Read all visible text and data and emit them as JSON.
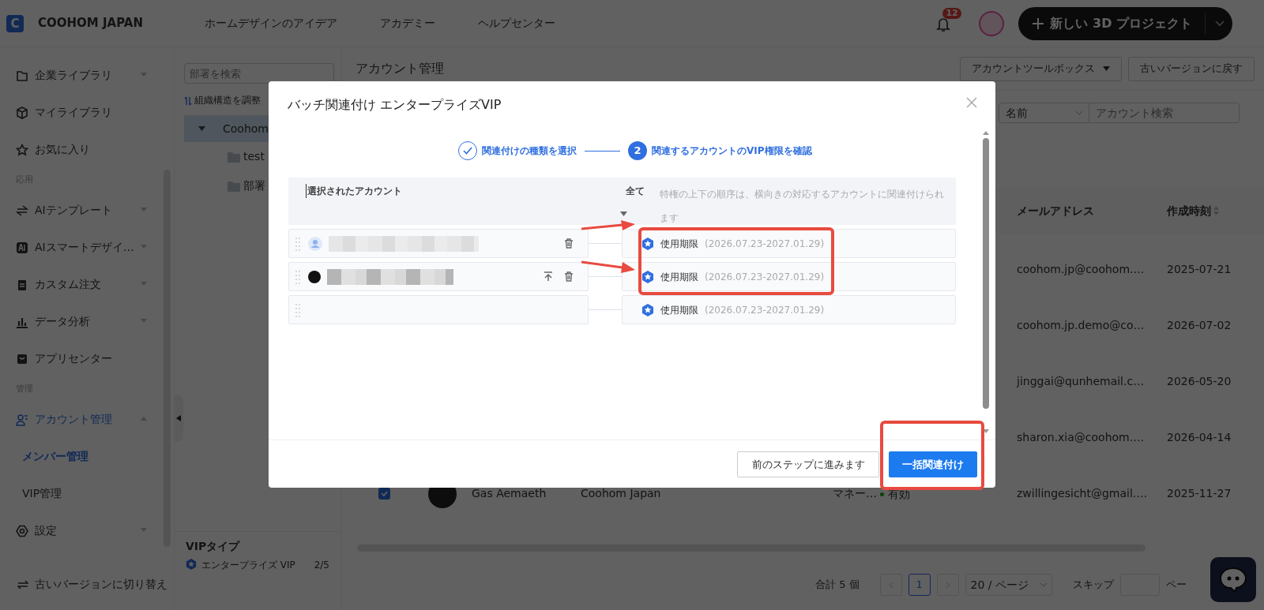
{
  "header": {
    "logo_letter": "C",
    "brand": "COOHOM JAPAN",
    "nav": [
      "ホームデザインのアイデア",
      "アカデミー",
      "ヘルプセンター"
    ],
    "notification_count": "12",
    "new_project_button": "新しい 3D プロジェクト"
  },
  "sidebar": {
    "items": [
      {
        "kind": "item",
        "label": "企業ライブラリ",
        "expanded": false,
        "selected": false
      },
      {
        "kind": "item",
        "label": "マイライブラリ",
        "selected": false
      },
      {
        "kind": "item",
        "label": "お気に入り",
        "selected": false
      },
      {
        "kind": "section",
        "label": "応用"
      },
      {
        "kind": "item",
        "label": "AIテンプレート",
        "expanded": false,
        "selected": false
      },
      {
        "kind": "item",
        "label": "AIスマートデザイ…",
        "expanded": false,
        "selected": false
      },
      {
        "kind": "item",
        "label": "カスタム注文",
        "expanded": false,
        "selected": false
      },
      {
        "kind": "item",
        "label": "データ分析",
        "expanded": false,
        "selected": false
      },
      {
        "kind": "item",
        "label": "アプリセンター",
        "selected": false
      },
      {
        "kind": "section",
        "label": "管理"
      },
      {
        "kind": "item",
        "label": "アカウント管理",
        "expanded": true,
        "selected": true
      },
      {
        "kind": "subitem",
        "label": "メンバー管理",
        "selected": true
      },
      {
        "kind": "subitem",
        "label": "VIP管理",
        "selected": false
      },
      {
        "kind": "item",
        "label": "設定",
        "expanded": false,
        "selected": false
      }
    ],
    "footer_link": "古いバージョンに切り替え"
  },
  "org_panel": {
    "search_placeholder": "部署を検索",
    "adjust_link": "組織構造を調整",
    "tree": [
      {
        "label": "Coohom",
        "selected": true,
        "expanded": true,
        "children": [
          {
            "label": "test",
            "selected": false
          },
          {
            "label": "部署",
            "selected": false
          }
        ]
      }
    ],
    "vip_type": {
      "title": "VIPタイプ",
      "items": [
        {
          "label": "エンタープライズ VIP",
          "count": "2/5"
        }
      ]
    }
  },
  "main": {
    "title": "アカウント管理",
    "toolbox_button": "アカウントツールボックス",
    "old_version_button": "古いバージョンに戻す",
    "search": {
      "field": "名前",
      "placeholder": "アカウント検索"
    },
    "table": {
      "columns": [
        "メールアドレス",
        "作成時刻"
      ],
      "rows": [
        {
          "email": "coohom.jp@coohom.…",
          "created": "2025-07-21"
        },
        {
          "email": "coohom.jp.demo@co…",
          "created": "2026-07-02"
        },
        {
          "email": "jinggai@qunhemail.c…",
          "created": "2026-05-20"
        },
        {
          "email": "sharon.xia@coohom.…",
          "created": "2026-04-14"
        },
        {
          "checked": true,
          "name": "Gas Aemaeth",
          "organization": "Coohom Japan",
          "role": "マネー…",
          "status": "有効",
          "email": "zwillingesicht@gmail.…",
          "created": "2025-11-27"
        }
      ]
    },
    "pagination": {
      "total": "合計 5 個",
      "pages": [
        {
          "label": "1",
          "selected": true
        }
      ],
      "page_size": "20 / ページ",
      "jump_label": "スキップ",
      "jump_suffix": "ペー"
    }
  },
  "modal": {
    "title": "バッチ関連付け エンタープライズVIP",
    "steps": [
      {
        "label": "関連付けの種類を選択",
        "done": true
      },
      {
        "number": "2",
        "label": "関連するアカウントのVIP権限を確認",
        "done": false
      }
    ],
    "accounts_header": "選択されたアカウント",
    "all_label": "全て",
    "hint": "特権の上下の順序は、横向きの対応するアカウントに関連付けられます",
    "accounts": [
      {
        "kind": "account",
        "has_photo": false,
        "move_top": false,
        "deletable": true
      },
      {
        "kind": "account",
        "has_photo": true,
        "move_top": true,
        "deletable": true
      },
      {
        "kind": "empty"
      }
    ],
    "privileges": [
      {
        "label": "使用期限",
        "period": "(2026.07.23-2027.01.29)"
      },
      {
        "label": "使用期限",
        "period": "(2026.07.23-2027.01.29)"
      },
      {
        "label": "使用期限",
        "period": "(2026.07.23-2027.01.29)"
      }
    ],
    "back_button": "前のステップに進みます",
    "confirm_button": "一括関連付け"
  }
}
